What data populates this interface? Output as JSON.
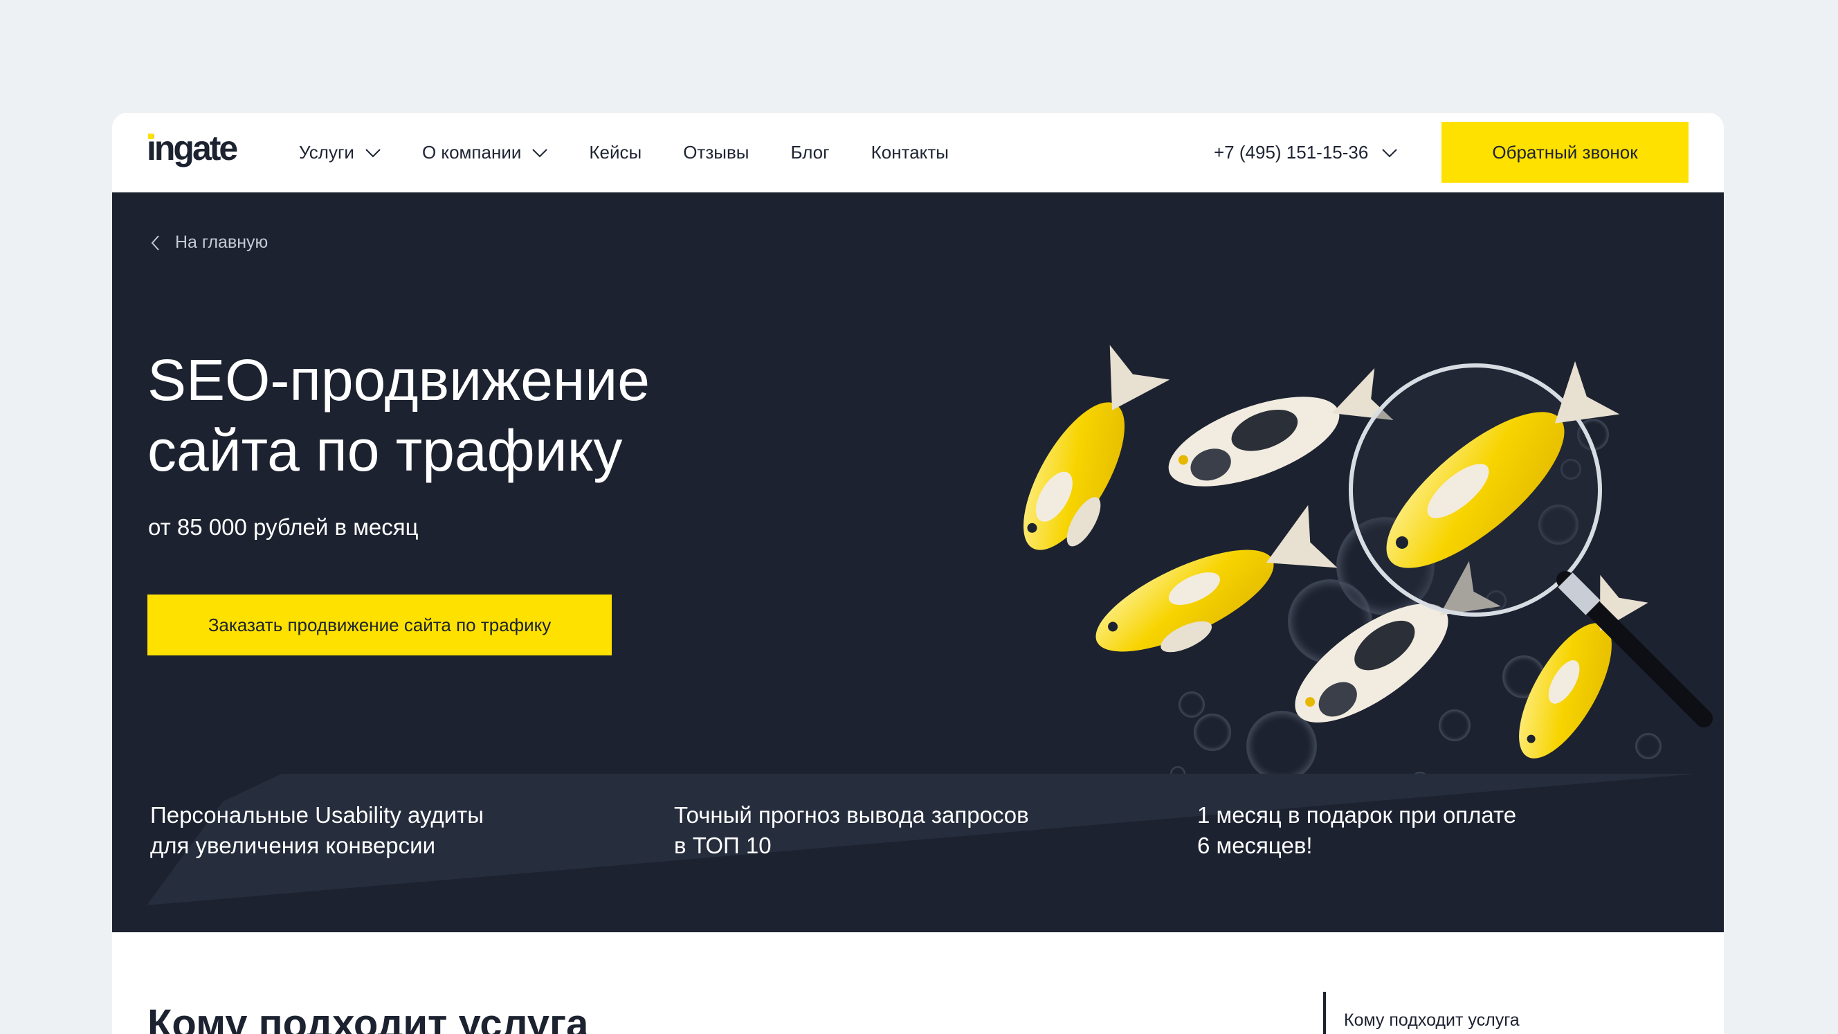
{
  "header": {
    "logo_text": "ingate",
    "nav": [
      {
        "label": "Услуги",
        "has_dropdown": true
      },
      {
        "label": "О компании",
        "has_dropdown": true
      },
      {
        "label": "Кейсы",
        "has_dropdown": false
      },
      {
        "label": "Отзывы",
        "has_dropdown": false
      },
      {
        "label": "Блог",
        "has_dropdown": false
      },
      {
        "label": "Контакты",
        "has_dropdown": false
      }
    ],
    "phone": "+7 (495) 151-15-36",
    "callback_label": "Обратный звонок"
  },
  "hero": {
    "breadcrumb": "На главную",
    "title_line1": "SEO-продвижение",
    "title_line2": "сайта по трафику",
    "price": "от 85 000 рублей в месяц",
    "cta_label": "Заказать продвижение сайта по трафику",
    "features": [
      {
        "line1": "Персональные Usability аудиты",
        "line2": "для увеличения конверсии"
      },
      {
        "line1": "Точный прогноз вывода запросов",
        "line2": "в ТОП 10"
      },
      {
        "line1": "1 месяц в подарок при оплате",
        "line2": "6 месяцев!"
      }
    ]
  },
  "content": {
    "section_title": "Кому подходит услуга",
    "toc_item": "Кому подходит услуга"
  },
  "colors": {
    "accent": "#ffe100",
    "hero_bg": "#1c2230",
    "page_bg": "#eef1f4"
  }
}
